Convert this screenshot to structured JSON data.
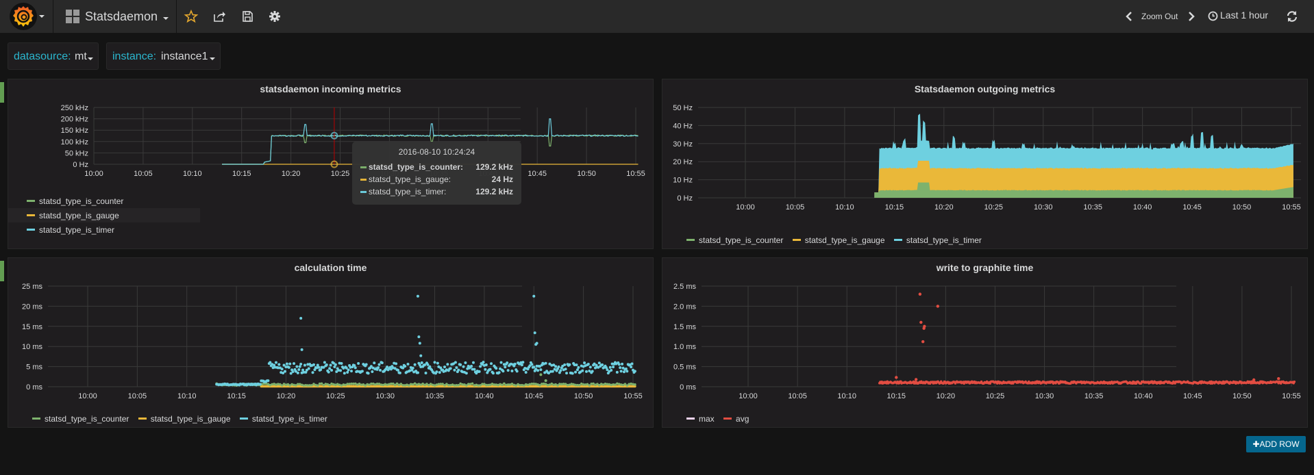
{
  "navbar": {
    "logo": "grafana-logo-icon",
    "dashboard_title": "Statsdaemon",
    "icons": [
      "star-icon",
      "share-icon",
      "save-icon",
      "gear-icon"
    ],
    "zoom_out_label": "Zoom Out",
    "time_range_label": "Last 1 hour",
    "colors": {
      "star": "#e5a82e",
      "text": "#d8d9da"
    }
  },
  "variables": [
    {
      "label": "datasource:",
      "value": "mt"
    },
    {
      "label": "instance:",
      "value": "instance1"
    }
  ],
  "colors": {
    "counter": "#7eb26d",
    "gauge": "#eab839",
    "timer": "#6ed0e0",
    "max": "#f4d5f5",
    "avg": "#e24d42",
    "add_row": "#05668d",
    "variable_label": "#2bb7cf"
  },
  "panels": {
    "incoming": {
      "title": "statsdaemon incoming metrics",
      "legend": [
        "statsd_type_is_counter",
        "statsd_type_is_gauge",
        "statsd_type_is_timer"
      ],
      "tooltip": {
        "time": "2016-08-10 10:24:24",
        "rows": [
          {
            "name": "statsd_type_is_counter:",
            "value": "129.2 kHz",
            "series": "counter"
          },
          {
            "name": "statsd_type_is_gauge:",
            "value": "24 Hz",
            "series": "gauge"
          },
          {
            "name": "statsd_type_is_timer:",
            "value": "129.2 kHz",
            "series": "timer"
          }
        ]
      }
    },
    "outgoing": {
      "title": "Statsdaemon outgoing metrics",
      "legend": [
        "statsd_type_is_counter",
        "statsd_type_is_gauge",
        "statsd_type_is_timer"
      ]
    },
    "calc": {
      "title": "calculation time",
      "legend": [
        "statsd_type_is_counter",
        "statsd_type_is_gauge",
        "statsd_type_is_timer"
      ]
    },
    "graphite": {
      "title": "write to graphite time",
      "legend": [
        "max",
        "avg"
      ]
    }
  },
  "add_row_label": "ADD ROW",
  "chart_data": [
    {
      "type": "line",
      "title": "statsdaemon incoming metrics",
      "x_ticks": [
        "10:00",
        "10:05",
        "10:10",
        "10:15",
        "10:20",
        "10:25",
        "10:30",
        "10:35",
        "10:40",
        "10:45",
        "10:50",
        "10:55"
      ],
      "y_ticks": [
        "0 Hz",
        "50 kHz",
        "100 kHz",
        "150 kHz",
        "200 kHz",
        "250 kHz"
      ],
      "ylim": [
        0,
        250
      ],
      "y_unit": "kHz",
      "x_range_minutes": [
        -5,
        56
      ],
      "series": [
        {
          "name": "statsd_type_is_counter",
          "key": "counter",
          "start": 13,
          "ramp_at": 18,
          "level": 126,
          "spikes": [
            [
              21.5,
              95
            ],
            [
              34.3,
              100
            ],
            [
              46.3,
              80
            ]
          ]
        },
        {
          "name": "statsd_type_is_gauge",
          "key": "gauge",
          "start": 13,
          "level": 0.024
        },
        {
          "name": "statsd_type_is_timer",
          "key": "timer",
          "start": 13,
          "ramp_at": 18,
          "level": 126,
          "spikes": [
            [
              21.5,
              175
            ],
            [
              34.3,
              178
            ],
            [
              46.3,
              200
            ]
          ]
        }
      ],
      "crosshair_time": "10:24:24",
      "legend_position": "bottom-left"
    },
    {
      "type": "area",
      "title": "Statsdaemon outgoing metrics",
      "stacked": true,
      "x_ticks": [
        "10:00",
        "10:05",
        "10:10",
        "10:15",
        "10:20",
        "10:25",
        "10:30",
        "10:35",
        "10:40",
        "10:45",
        "10:50",
        "10:55"
      ],
      "y_ticks": [
        "0 Hz",
        "10 Hz",
        "20 Hz",
        "30 Hz",
        "40 Hz",
        "50 Hz"
      ],
      "ylim": [
        0,
        50
      ],
      "y_unit": "Hz",
      "series": [
        {
          "name": "statsd_type_is_counter",
          "key": "counter",
          "start": 13,
          "level": 4,
          "bump": [
            17.5,
            18.5,
            8.5
          ],
          "end_level": 6
        },
        {
          "name": "statsd_type_is_gauge",
          "key": "gauge",
          "start": 13.4,
          "level": 12,
          "bump": [
            17.5,
            18.5,
            12
          ],
          "end_level": 12
        },
        {
          "name": "statsd_type_is_timer",
          "key": "timer",
          "start": 13.4,
          "level": 11,
          "spikes": [
            [
              15,
              31
            ],
            [
              16,
              33
            ],
            [
              17.5,
              43
            ],
            [
              18,
              39
            ],
            [
              21,
              34
            ],
            [
              22,
              31
            ],
            [
              25,
              32
            ],
            [
              28,
              31
            ],
            [
              33,
              30
            ],
            [
              41,
              28
            ],
            [
              43,
              30
            ],
            [
              44,
              32
            ],
            [
              45,
              35
            ],
            [
              46,
              37
            ],
            [
              47,
              35
            ],
            [
              50,
              30
            ],
            [
              53,
              28
            ]
          ],
          "end_level": 30
        }
      ],
      "legend_position": "bottom"
    },
    {
      "type": "scatter",
      "title": "calculation time",
      "x_ticks": [
        "10:00",
        "10:05",
        "10:10",
        "10:15",
        "10:20",
        "10:25",
        "10:30",
        "10:35",
        "10:40",
        "10:45",
        "10:50",
        "10:55"
      ],
      "y_ticks": [
        "0 ms",
        "5 ms",
        "10 ms",
        "15 ms",
        "20 ms",
        "25 ms"
      ],
      "ylim": [
        0,
        25
      ],
      "y_unit": "ms",
      "series": [
        {
          "name": "statsd_type_is_counter",
          "key": "counter",
          "start": 13,
          "level": 0.3,
          "outliers": [
            [
              45.7,
              3.0
            ],
            [
              46.2,
              1.5
            ]
          ]
        },
        {
          "name": "statsd_type_is_gauge",
          "key": "gauge",
          "start": 17.5,
          "level": 0.1
        },
        {
          "name": "statsd_type_is_timer",
          "key": "timer",
          "start": 13,
          "low_level": 0.5,
          "ramp_at": 18.3,
          "level": 4.5,
          "outliers": [
            [
              21.5,
              17
            ],
            [
              21.6,
              9.2
            ],
            [
              33.3,
              22.5
            ],
            [
              33.4,
              12.4
            ],
            [
              33.5,
              10.8
            ],
            [
              33.6,
              7.7
            ],
            [
              45.0,
              22.5
            ],
            [
              45.1,
              13.4
            ],
            [
              45.2,
              10.5
            ],
            [
              45.3,
              10.8
            ]
          ]
        }
      ],
      "legend_position": "bottom"
    },
    {
      "type": "scatter",
      "title": "write to graphite time",
      "x_ticks": [
        "10:00",
        "10:05",
        "10:10",
        "10:15",
        "10:20",
        "10:25",
        "10:30",
        "10:35",
        "10:40",
        "10:45",
        "10:50",
        "10:55"
      ],
      "y_ticks": [
        "0 ms",
        "0.5 ms",
        "1.0 ms",
        "1.5 ms",
        "2.0 ms",
        "2.5 ms"
      ],
      "ylim": [
        0,
        2.5
      ],
      "y_unit": "ms",
      "series": [
        {
          "name": "max",
          "key": "max",
          "values": []
        },
        {
          "name": "avg",
          "key": "avg",
          "start": 13.3,
          "level": 0.09,
          "outliers": [
            [
              15,
              0.23
            ],
            [
              17,
              0.18
            ],
            [
              17.4,
              2.3
            ],
            [
              17.5,
              1.6
            ],
            [
              17.7,
              1.12
            ],
            [
              17.8,
              1.45
            ],
            [
              17.85,
              1.5
            ],
            [
              19.2,
              2.0
            ],
            [
              51.2,
              0.17
            ],
            [
              53.7,
              0.2
            ]
          ]
        }
      ],
      "legend_position": "bottom-left"
    }
  ]
}
